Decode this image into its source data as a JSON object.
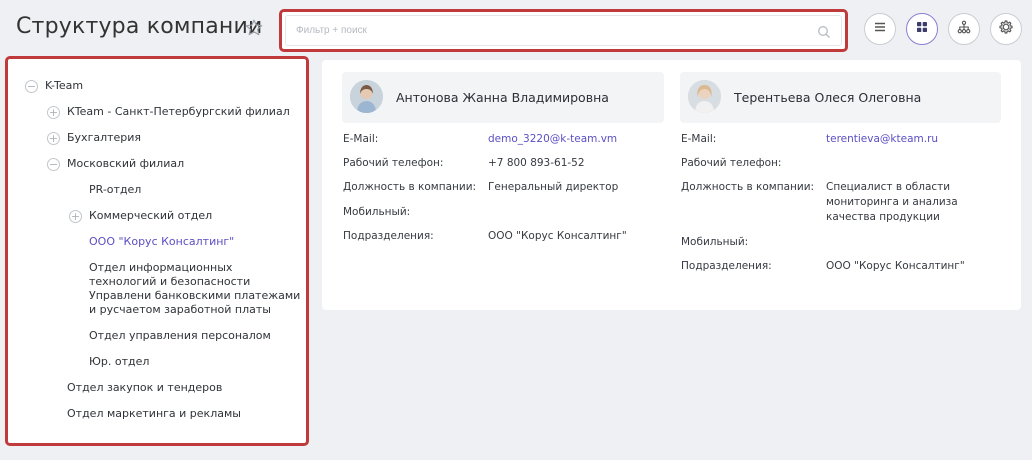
{
  "header": {
    "title": "Структура компании",
    "search_placeholder": "Фильтр + поиск",
    "toolbar": {
      "list_view": "list-icon",
      "grid_view": "grid-icon",
      "tree_view": "hierarchy-icon",
      "settings": "gear-icon"
    }
  },
  "tree": {
    "root": "K-Team",
    "items": [
      {
        "label": "КTeam - Санкт-Петербургский филиал",
        "toggle": "+"
      },
      {
        "label": "Бухгалтерия",
        "toggle": "+"
      },
      {
        "label": "Московский филиал",
        "toggle": "−"
      },
      {
        "label": "PR-отдел",
        "toggle": ""
      },
      {
        "label": "Коммерческий отдел",
        "toggle": "+"
      },
      {
        "label": "ООО \"Корус Консалтинг\"",
        "toggle": ""
      },
      {
        "label": "Отдел информационных технологий и безопасности Управлени банковскими платежами и русчаетом заработной платы",
        "toggle": ""
      },
      {
        "label": "Отдел управления персоналом",
        "toggle": ""
      },
      {
        "label": "Юр. отдел",
        "toggle": ""
      },
      {
        "label": "Отдел закупок и тендеров",
        "toggle": ""
      },
      {
        "label": "Отдел маркетинга и рекламы",
        "toggle": ""
      }
    ],
    "root_toggle": "−",
    "selected_color": "#5b4fc4"
  },
  "cards": [
    {
      "name": "Антонова Жанна Владимировна",
      "labels": {
        "email": "E-Mail:",
        "work_phone": "Рабочий телефон:",
        "position": "Должность в компании:",
        "mobile": "Мобильный:",
        "department": "Подразделения:"
      },
      "values": {
        "email": "demo_3220@k-team.vm",
        "work_phone": "+7 800 893-61-52",
        "position": "Генеральный директор",
        "mobile": "",
        "department": "ООО \"Корус Консалтинг\""
      }
    },
    {
      "name": "Терентьева Олеся Олеговна",
      "labels": {
        "email": "E-Mail:",
        "work_phone": "Рабочий телефон:",
        "position": "Должность в компании:",
        "mobile": "Мобильный:",
        "department": "Подразделения:"
      },
      "values": {
        "email": "terentieva@kteam.ru",
        "work_phone": "",
        "position": "Специалист в области мониторинга и анализа качества продукции",
        "mobile": "",
        "department": "ООО \"Корус Консалтинг\""
      }
    }
  ],
  "colors": {
    "highlight_border": "#c0393b",
    "link": "#5b4fc4",
    "background": "#eef0f3"
  }
}
